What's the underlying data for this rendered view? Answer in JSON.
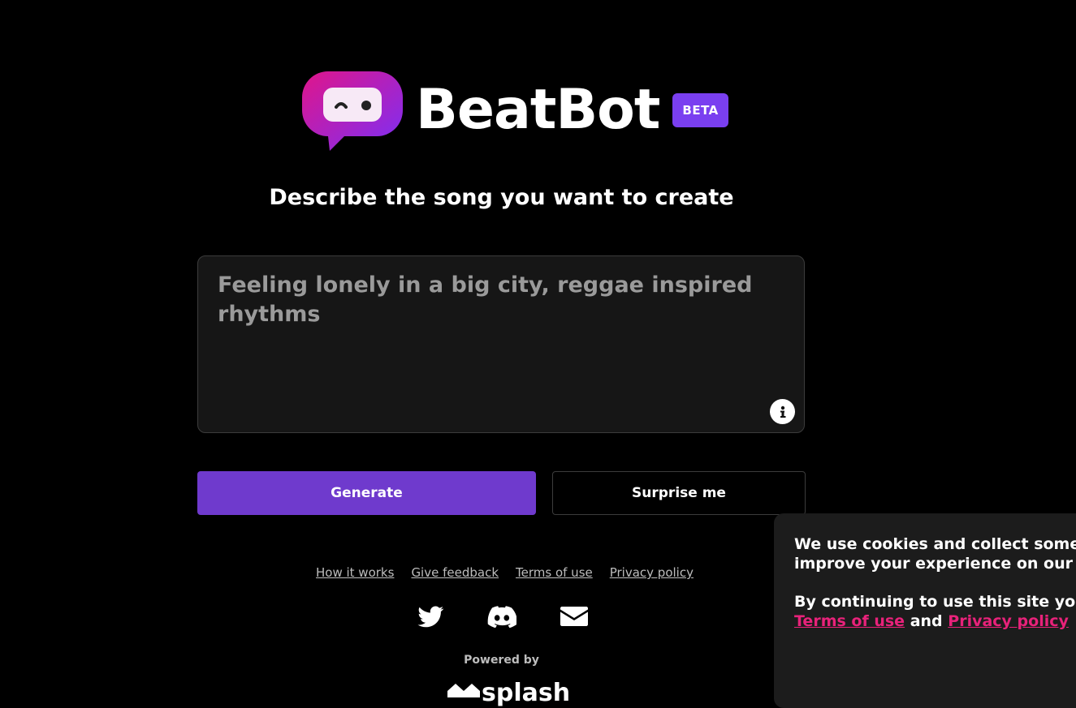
{
  "header": {
    "brand": "BeatBot",
    "badge": "BETA"
  },
  "subtitle": "Describe the song you want to create",
  "prompt": {
    "value": "",
    "placeholder": "Feeling lonely in a big city, reggae inspired rhythms"
  },
  "buttons": {
    "generate": "Generate",
    "surprise": "Surprise me"
  },
  "footer": {
    "links": [
      "How it works",
      "Give feedback",
      "Terms of use",
      "Privacy policy"
    ],
    "social_icons": [
      "twitter-icon",
      "discord-icon",
      "mail-icon"
    ],
    "powered_by": "Powered by",
    "splash_logo_text": "splash"
  },
  "cookie_banner": {
    "line1": "We use cookies and collect some ba",
    "line2": "improve your experience on our site",
    "line3": "By continuing to use this site you ag",
    "terms_link": "Terms of use",
    "and": "and",
    "privacy_link": "Privacy policy"
  },
  "colors": {
    "background": "#000000",
    "accent_purple": "#6f3acd",
    "beta_badge": "#7a3ff0",
    "link_pink": "#e8227a",
    "logo_gradient_start": "#e0158a",
    "logo_gradient_end": "#7b2ff7"
  }
}
